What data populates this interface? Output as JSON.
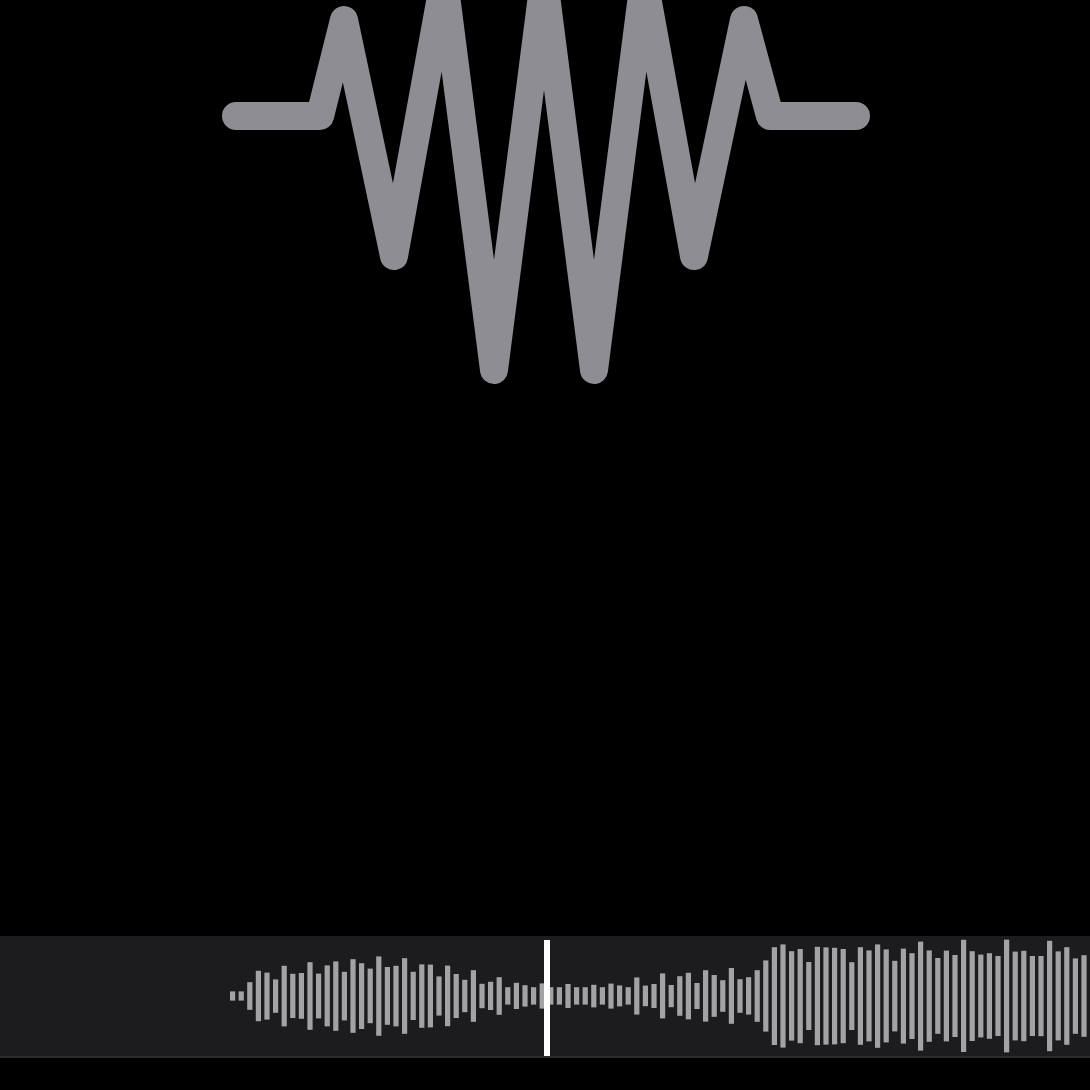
{
  "scrubber": {
    "level": 0.5
  }
}
